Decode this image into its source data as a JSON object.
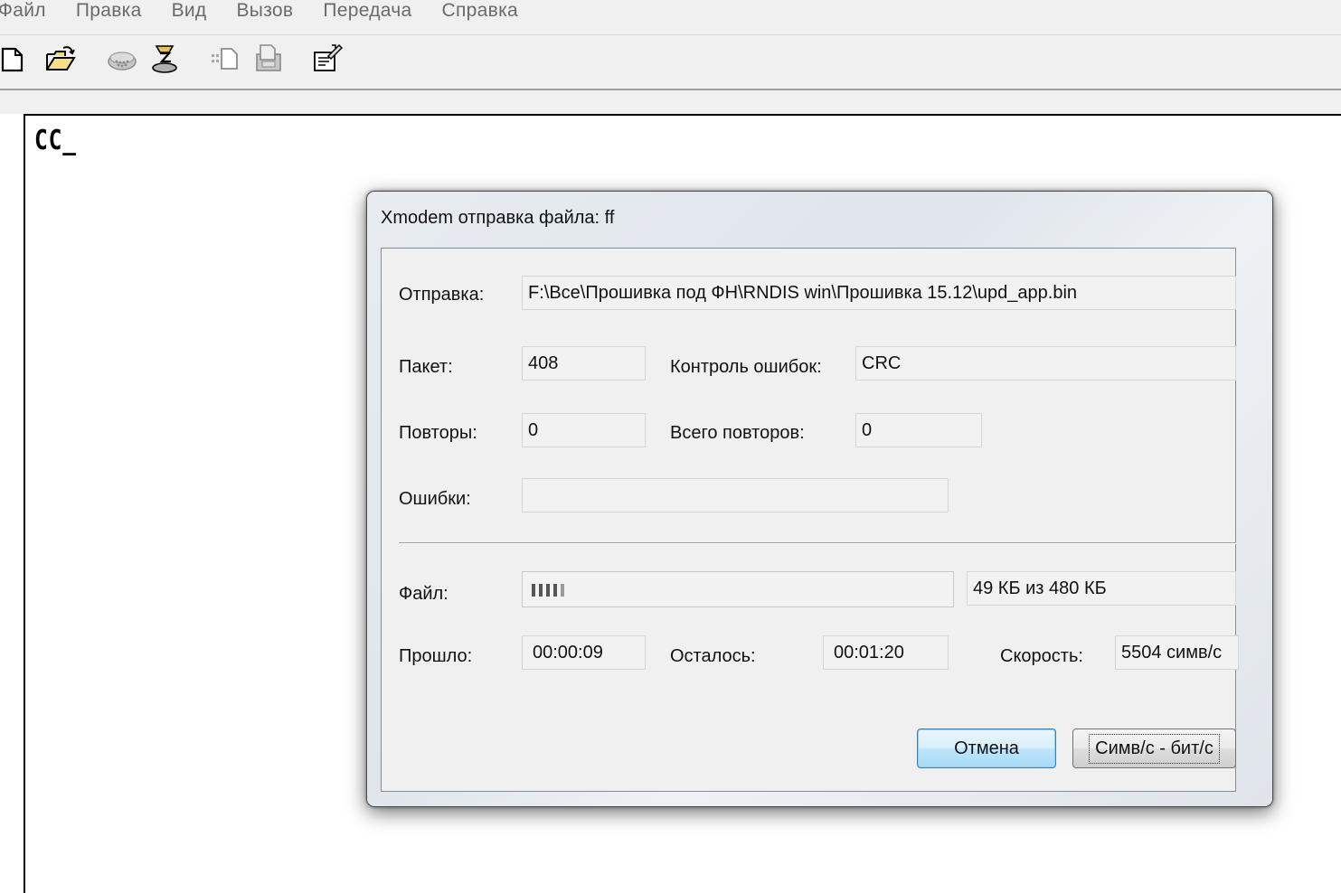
{
  "menu": {
    "items": [
      "Файл",
      "Правка",
      "Вид",
      "Вызов",
      "Передача",
      "Справка"
    ]
  },
  "toolbar": {
    "icons": [
      "new-file-icon",
      "open-folder-icon",
      "connect-phone-icon",
      "disconnect-icon",
      "send-icon",
      "receive-icon",
      "properties-icon"
    ]
  },
  "terminal": {
    "text": "CC_"
  },
  "dialog": {
    "title": "Xmodem отправка файла: ff",
    "send_label": "Отправка:",
    "send_value": "F:\\Все\\Прошивка под ФН\\RNDIS win\\Прошивка 15.12\\upd_app.bin",
    "packet_label": "Пакет:",
    "packet_value": "408",
    "error_check_label": "Контроль ошибок:",
    "error_check_value": "CRC",
    "retries_label": "Повторы:",
    "retries_value": "0",
    "total_retries_label": "Всего повторов:",
    "total_retries_value": "0",
    "errors_label": "Ошибки:",
    "errors_value": "",
    "file_label": "Файл:",
    "file_progress_fraction": 0.102,
    "file_size_value": "49 КБ из 480 КБ",
    "elapsed_label": "Прошло:",
    "elapsed_value": "00:00:09",
    "remaining_label": "Осталось:",
    "remaining_value": "00:01:20",
    "speed_label": "Скорость:",
    "speed_value": "5504 симв/с",
    "cancel_button": "Отмена",
    "toggle_units_button": "Симв/с - бит/с"
  }
}
